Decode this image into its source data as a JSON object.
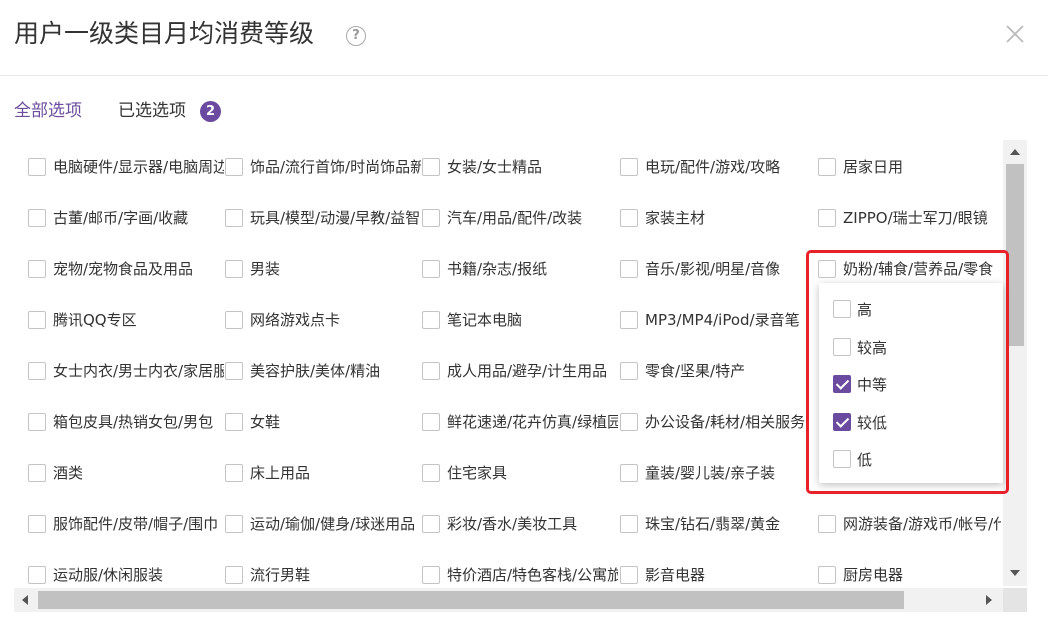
{
  "dialog": {
    "title": "用户一级类目月均消费等级",
    "help_icon": "?",
    "close_icon": "close-icon"
  },
  "tabs": {
    "all_label": "全部选项",
    "selected_label": "已选选项",
    "selected_count": "2"
  },
  "categories": [
    [
      "电脑硬件/显示器/电脑周边",
      "饰品/流行首饰/时尚饰品新",
      "女装/女士精品",
      "电玩/配件/游戏/攻略",
      "居家日用"
    ],
    [
      "古董/邮币/字画/收藏",
      "玩具/模型/动漫/早教/益智",
      "汽车/用品/配件/改装",
      "家装主材",
      "ZIPPO/瑞士军刀/眼镜"
    ],
    [
      "宠物/宠物食品及用品",
      "男装",
      "书籍/杂志/报纸",
      "音乐/影视/明星/音像",
      "奶粉/辅食/营养品/零食"
    ],
    [
      "腾讯QQ专区",
      "网络游戏点卡",
      "笔记本电脑",
      "MP3/MP4/iPod/录音笔",
      ""
    ],
    [
      "女士内衣/男士内衣/家居服",
      "美容护肤/美体/精油",
      "成人用品/避孕/计生用品",
      "零食/坚果/特产",
      ""
    ],
    [
      "箱包皮具/热销女包/男包",
      "女鞋",
      "鲜花速递/花卉仿真/绿植园艺",
      "办公设备/耗材/相关服务",
      ""
    ],
    [
      "酒类",
      "床上用品",
      "住宅家具",
      "童装/婴儿装/亲子装",
      ""
    ],
    [
      "服饰配件/皮带/帽子/围巾",
      "运动/瑜伽/健身/球迷用品",
      "彩妆/香水/美妆工具",
      "珠宝/钻石/翡翠/黄金",
      "网游装备/游戏币/帐号/代练"
    ],
    [
      "运动服/休闲服装",
      "流行男鞋",
      "特价酒店/特色客栈/公寓旅馆",
      "影音电器",
      "厨房电器"
    ]
  ],
  "dropdown": {
    "options": [
      {
        "label": "高",
        "checked": false
      },
      {
        "label": "较高",
        "checked": false
      },
      {
        "label": "中等",
        "checked": true
      },
      {
        "label": "较低",
        "checked": true
      },
      {
        "label": "低",
        "checked": false
      }
    ]
  },
  "colors": {
    "accent": "#6b4ba0",
    "highlight": "#e8202a"
  }
}
